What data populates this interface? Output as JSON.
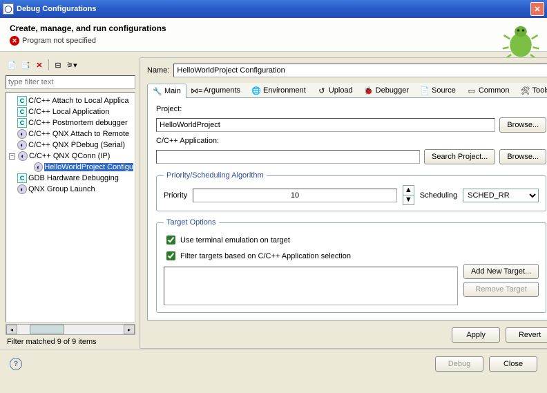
{
  "window": {
    "title": "Debug Configurations"
  },
  "header": {
    "title": "Create, manage, and run configurations",
    "error": "Program not specified"
  },
  "filter": {
    "placeholder": "type filter text"
  },
  "tree": {
    "items": [
      {
        "label": "C/C++ Attach to Local Applica"
      },
      {
        "label": "C/C++ Local Application"
      },
      {
        "label": "C/C++ Postmortem debugger"
      },
      {
        "label": "C/C++ QNX Attach to Remote"
      },
      {
        "label": "C/C++ QNX PDebug (Serial)"
      },
      {
        "label": "C/C++ QNX QConn (IP)"
      },
      {
        "label": "HelloWorldProject Configu"
      },
      {
        "label": "GDB Hardware Debugging"
      },
      {
        "label": "QNX Group Launch"
      }
    ]
  },
  "status": "Filter matched 9 of 9 items",
  "name": {
    "label": "Name:",
    "value": "HelloWorldProject Configuration"
  },
  "tabs": {
    "items": [
      {
        "label": "Main"
      },
      {
        "label": "Arguments"
      },
      {
        "label": "Environment"
      },
      {
        "label": "Upload"
      },
      {
        "label": "Debugger"
      },
      {
        "label": "Source"
      },
      {
        "label": "Common"
      },
      {
        "label": "Tools"
      }
    ]
  },
  "main": {
    "project_label": "Project:",
    "project_value": "HelloWorldProject",
    "browse": "Browse...",
    "app_label": "C/C++ Application:",
    "app_value": "",
    "search_project": "Search Project...",
    "priority_legend": "Priority/Scheduling Algorithm",
    "priority_label": "Priority",
    "priority_value": "10",
    "scheduling_label": "Scheduling",
    "scheduling_value": "SCHED_RR",
    "target_legend": "Target Options",
    "terminal_label": "Use terminal emulation on target",
    "filter_label": "Filter targets based on C/C++ Application selection",
    "add_target": "Add New Target...",
    "remove_target": "Remove Target"
  },
  "buttons": {
    "apply": "Apply",
    "revert": "Revert",
    "debug": "Debug",
    "close": "Close"
  }
}
